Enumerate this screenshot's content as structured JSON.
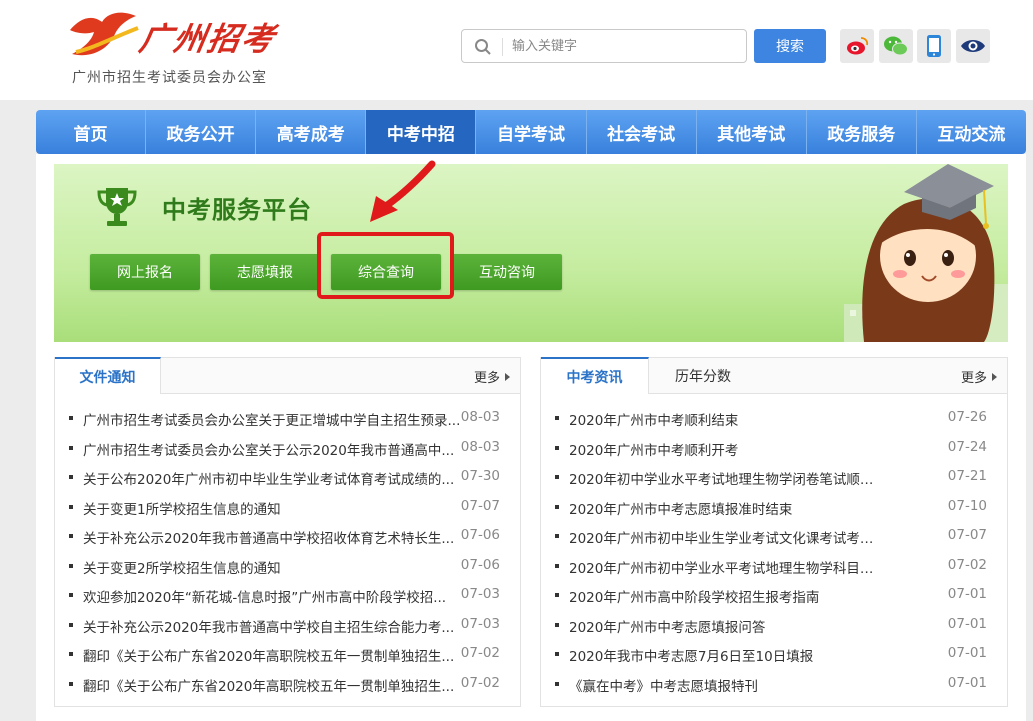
{
  "header": {
    "logo_text": "广州招考",
    "subtitle": "广州市招生考试委员会办公室",
    "search_placeholder": "输入关键字",
    "search_button": "搜索",
    "social_icons": [
      "weibo-icon",
      "wechat-icon",
      "mobile-icon",
      "eye-icon"
    ]
  },
  "nav": {
    "items": [
      "首页",
      "政务公开",
      "高考成考",
      "中考中招",
      "自学考试",
      "社会考试",
      "其他考试",
      "政务服务",
      "互动交流"
    ],
    "active_index": 3
  },
  "banner": {
    "title": "中考服务平台",
    "buttons": [
      "网上报名",
      "志愿填报",
      "综合查询",
      "互动咨询"
    ],
    "highlighted_button": "综合查询"
  },
  "left_panel": {
    "tabs": [
      "文件通知"
    ],
    "more": "更多",
    "items": [
      {
        "title": "广州市招生考试委员会办公室关于更正增城中学自主招生预录...",
        "date": "08-03"
      },
      {
        "title": "广州市招生考试委员会办公室关于公示2020年我市普通高中...",
        "date": "08-03"
      },
      {
        "title": "关于公布2020年广州市初中毕业生学业考试体育考试成绩的...",
        "date": "07-30"
      },
      {
        "title": "关于变更1所学校招生信息的通知",
        "date": "07-07"
      },
      {
        "title": "关于补充公示2020年我市普通高中学校招收体育艺术特长生...",
        "date": "07-06"
      },
      {
        "title": "关于变更2所学校招生信息的通知",
        "date": "07-06"
      },
      {
        "title": "欢迎参加2020年“新花城-信息时报”广州市高中阶段学校招...",
        "date": "07-03"
      },
      {
        "title": "关于补充公示2020年我市普通高中学校自主招生综合能力考...",
        "date": "07-03"
      },
      {
        "title": "翻印《关于公布广东省2020年高职院校五年一贯制单独招生...",
        "date": "07-02"
      },
      {
        "title": "翻印《关于公布广东省2020年高职院校五年一贯制单独招生...",
        "date": "07-02"
      }
    ]
  },
  "right_panel": {
    "tabs": [
      "中考资讯",
      "历年分数"
    ],
    "more": "更多",
    "items": [
      {
        "title": "2020年广州市中考顺利结束",
        "date": "07-26"
      },
      {
        "title": "2020年广州市中考顺利开考",
        "date": "07-24"
      },
      {
        "title": "2020年初中学业水平考试地理生物学闭卷笔试顺利...",
        "date": "07-21"
      },
      {
        "title": "2020年广州市中考志愿填报准时结束",
        "date": "07-10"
      },
      {
        "title": "2020年广州市初中毕业生学业考试文化课考试考生...",
        "date": "07-07"
      },
      {
        "title": "2020年广州市初中学业水平考试地理生物学科目考...",
        "date": "07-02"
      },
      {
        "title": "2020年广州市高中阶段学校招生报考指南",
        "date": "07-01"
      },
      {
        "title": "2020年广州市中考志愿填报问答",
        "date": "07-01"
      },
      {
        "title": "2020年我市中考志愿7月6日至10日填报",
        "date": "07-01"
      },
      {
        "title": "《赢在中考》中考志愿填报特刊",
        "date": "07-01"
      }
    ]
  },
  "colors": {
    "nav_blue": "#3880dc",
    "nav_active": "#2567c0",
    "banner_green": "#c5ec9f",
    "button_green": "#3f9a22",
    "highlight_red": "#e01a1a"
  }
}
